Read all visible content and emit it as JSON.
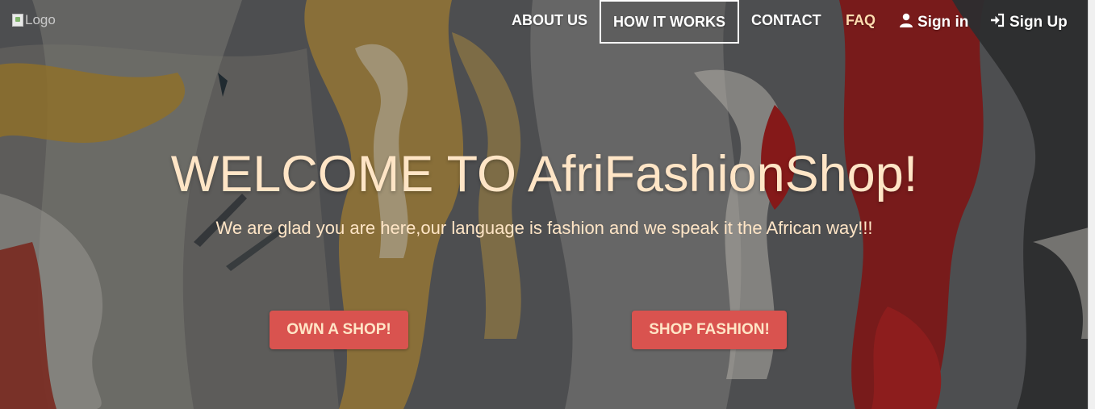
{
  "brand": {
    "logo_alt": "Logo"
  },
  "nav": {
    "items": [
      {
        "label": "ABOUT US"
      },
      {
        "label": "HOW IT WORKS"
      },
      {
        "label": "CONTACT"
      },
      {
        "label": "FAQ"
      },
      {
        "label": "Sign in",
        "icon": "user-icon"
      },
      {
        "label": "Sign Up",
        "icon": "sign-in-arrow-icon"
      }
    ]
  },
  "hero": {
    "title": "WELCOME TO AfriFashionShop!",
    "subtitle": "We are glad you are here,our language is fashion and we speak it the African way!!!",
    "buttons": [
      {
        "label": "OWN A SHOP!"
      },
      {
        "label": "SHOP FASHION!"
      }
    ]
  },
  "colors": {
    "accent_button": "#d9534f",
    "hero_text": "#ffe5c6",
    "faq_text": "#ffdcb0"
  }
}
